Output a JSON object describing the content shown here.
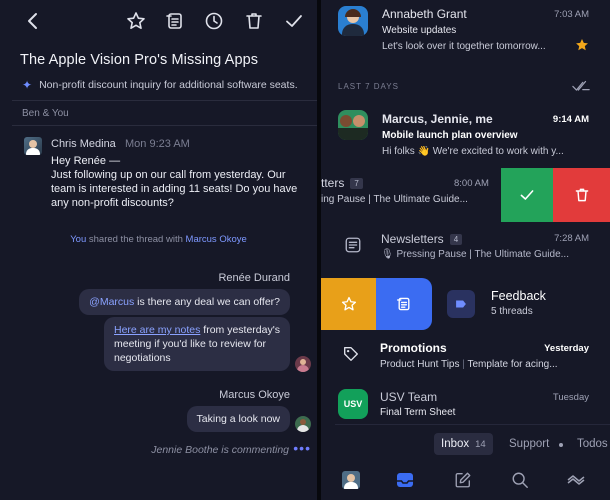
{
  "thread": {
    "subject": "The Apple Vision Pro's Missing Apps",
    "summary": "Non-profit discount inquiry for additional software seats.",
    "participants": "Ben & You",
    "message": {
      "sender": "Chris Medina",
      "time": "Mon 9:23 AM",
      "body": "Hey Renée —\nJust following up on our call from yesterday. Our team is interested in adding 11 seats! Do you have any non-profit discounts?"
    },
    "shared": {
      "actor": "You",
      "text": "shared the thread with",
      "target": "Marcus Okoye"
    },
    "comments": [
      {
        "author": "Renée Durand",
        "mention": "@Marcus",
        "text": " is there any deal we can offer?"
      },
      {
        "link_text": "Here are my notes",
        "text": " from yesterday's meeting if you'd like to review for negotiations"
      },
      {
        "author": "Marcus Okoye",
        "text": "Taking a look now"
      }
    ],
    "typing": "Jennie Boothe is commenting",
    "typing_dots": "•••"
  },
  "inbox": {
    "top_row": {
      "title": "Annabeth Grant",
      "subtitle": "Website updates",
      "preview": "Let's look over it together tomorrow...",
      "time": "7:03 AM"
    },
    "section": "LAST 7 DAYS",
    "rows": [
      {
        "title": "Marcus, Jennie, me",
        "subtitle": "Mobile launch plan overview",
        "preview": "Hi folks 👋 We're excited to work with y...",
        "time": "9:14 AM"
      },
      {
        "title": "tters",
        "count": "7",
        "preview": "ing Pause | The Ultimate Guide...",
        "time": "8:00 AM"
      },
      {
        "title": "Newsletters",
        "count": "4",
        "preview": "Pressing Pause | The Ultimate Guide...",
        "preview_icon": "🎙",
        "time": "7:28 AM"
      },
      {
        "title": "Feedback",
        "subtitle": "5 threads"
      },
      {
        "title": "Promotions",
        "preview_a": "Product Hunt Tips",
        "preview_b": "Template for acing...",
        "time": "Yesterday"
      },
      {
        "title": "USV Team",
        "avatar_text": "USV",
        "subtitle": "Final Term Sheet",
        "time": "Tuesday"
      }
    ],
    "tabs": {
      "inbox": "Inbox",
      "inbox_count": "14",
      "support": "Support",
      "todos": "Todos"
    }
  },
  "colors": {
    "accent_blue": "#3b6cf2",
    "swipe_green": "#23a35a",
    "swipe_red": "#e23b3b",
    "swipe_yellow": "#e8a019",
    "star": "#f2a71b",
    "usv_green": "#12a05a"
  }
}
